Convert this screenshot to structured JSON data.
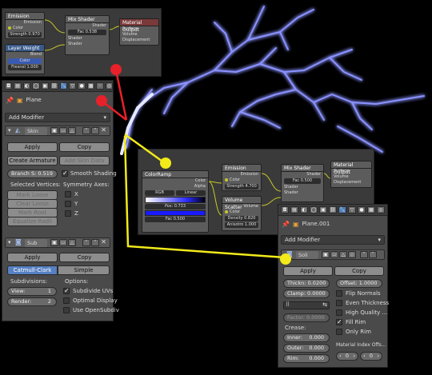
{
  "node_editor_1": {
    "nodes": [
      {
        "title": "Emission",
        "rows": [
          "Emission",
          "Color",
          "Strength 0.970"
        ]
      },
      {
        "title": "Mix Shader",
        "rows": [
          "Shader",
          "Fac 0.538",
          "Shader",
          "Shader"
        ]
      },
      {
        "title": "Material Output",
        "rows": [
          "Surface",
          "Volume",
          "Displacement"
        ]
      },
      {
        "title": "Layer Weight",
        "rows": [
          "Blend",
          "Color",
          "Fresnel 1.000"
        ]
      }
    ]
  },
  "properties_1": {
    "object_name": "Plane",
    "add_modifier": "Add Modifier",
    "skin": {
      "name": "Skin",
      "apply": "Apply",
      "copy": "Copy",
      "create_armature": "Create Armature",
      "add_skin_data": "Add Skin Data",
      "branch_smoothing": "Branch S: 0.519",
      "smooth_shading": "Smooth Shading",
      "selected_vertices": "Selected Vertices:",
      "symmetry_axes": "Symmetry Axes:",
      "mark_loose": "Mark Loose",
      "clear_loose": "Clear Loose",
      "mark_root": "Mark Root",
      "equalize_radii": "Equalize Radii",
      "axes": [
        "X",
        "Y",
        "Z"
      ]
    },
    "subsurf": {
      "name": "Sub",
      "apply": "Apply",
      "copy": "Copy",
      "catmull": "Catmull-Clark",
      "simple": "Simple",
      "subdivisions": "Subdivisions:",
      "options": "Options:",
      "view": "View:",
      "view_val": "1",
      "render": "Render:",
      "render_val": "2",
      "subdivide_uvs": "Subdivide UVs",
      "optimal_display": "Optimal Display",
      "use_opensubdiv": "Use OpenSubdiv"
    }
  },
  "node_editor_2": {
    "nodes": [
      {
        "title": "ColorRamp",
        "rows": [
          "Color",
          "Alpha",
          "RGB",
          "Linear",
          "Pos: 0.733",
          "Fac 0.500"
        ]
      },
      {
        "title": "Emission",
        "rows": [
          "Emission",
          "Color",
          "Strength 4.700"
        ]
      },
      {
        "title": "Mix Shader",
        "rows": [
          "Shader",
          "Fac 0.500",
          "Shader",
          "Shader"
        ]
      },
      {
        "title": "Material Output",
        "rows": [
          "Surface",
          "Volume",
          "Displacement"
        ]
      },
      {
        "title": "Volume Scatter",
        "rows": [
          "Volume",
          "Color",
          "Density 0.820",
          "Anisotro 1.000"
        ]
      }
    ]
  },
  "properties_2": {
    "object_name": "Plane.001",
    "add_modifier": "Add Modifier",
    "solidify": {
      "name": "Soli",
      "apply": "Apply",
      "copy": "Copy",
      "thickness": "Thickn: 0.0200",
      "offset": "Offset: 1.0000",
      "clamp": "Clamp: 0.0000",
      "flip_normals": "Flip Normals",
      "even_thickness": "Even Thickness",
      "high_quality": "High Quality ...",
      "factor": "Factor: 0.0000",
      "fill_rim": "Fill Rim",
      "only_rim": "Only Rim",
      "crease": "Crease:",
      "inner": "Inner:",
      "inner_val": "0.000",
      "outer": "Outer:",
      "outer_val": "0.000",
      "rim": "Rim:",
      "rim_val": "0.000",
      "material_index": "Material Index Offs...",
      "mat_val": "0",
      "mat_rim_val": "0"
    }
  },
  "colors": {
    "annotation_red": "#e8202a",
    "annotation_yellow": "#f2ea1a",
    "glow": "#6a74ff",
    "blue_button": "#5680c2"
  }
}
